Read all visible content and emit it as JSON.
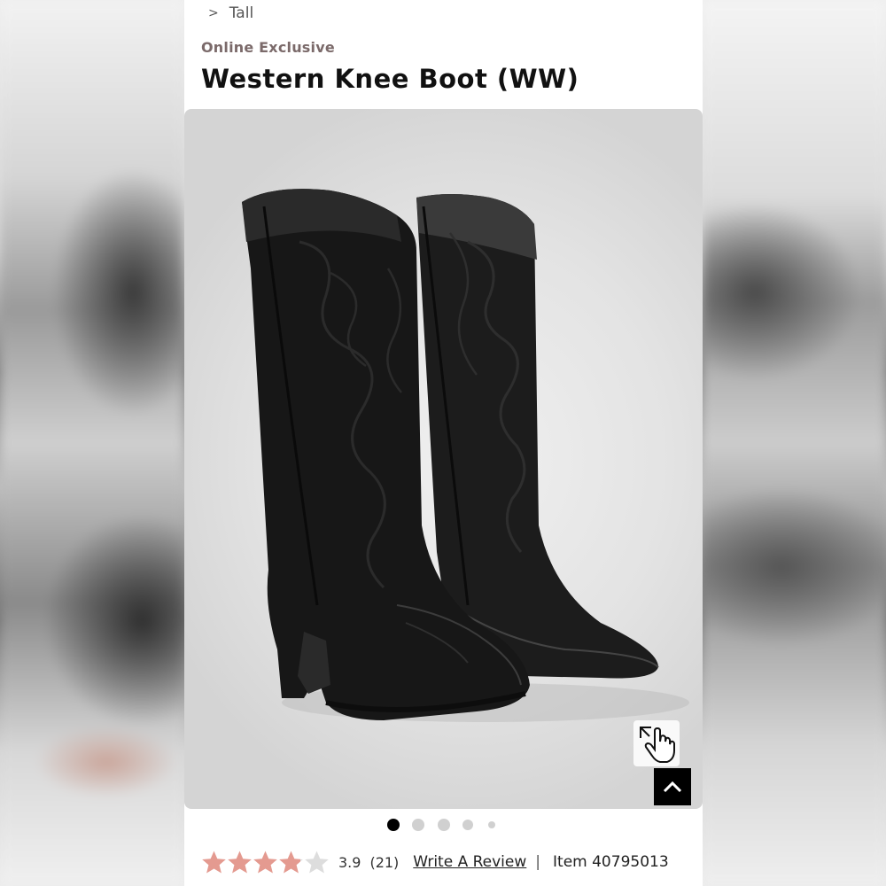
{
  "breadcrumb": {
    "separator": ">",
    "current": "Tall"
  },
  "product": {
    "badge": "Online Exclusive",
    "title": "Western Knee Boot (WW)",
    "image_alt": "black western knee boots",
    "carousel": {
      "count": 5,
      "active_index": 0
    }
  },
  "rating": {
    "value": "3.9",
    "count": "(21)",
    "stars_value": 3.9,
    "stars_max": 5,
    "star_color": "#e49a90",
    "empty_star_color": "#dddddd"
  },
  "review_link": "Write A Review",
  "divider": "|",
  "item": "Item 40795013",
  "icons": {
    "zoom": "expand-hand-icon",
    "scroll_top": "chevron-up-icon"
  }
}
